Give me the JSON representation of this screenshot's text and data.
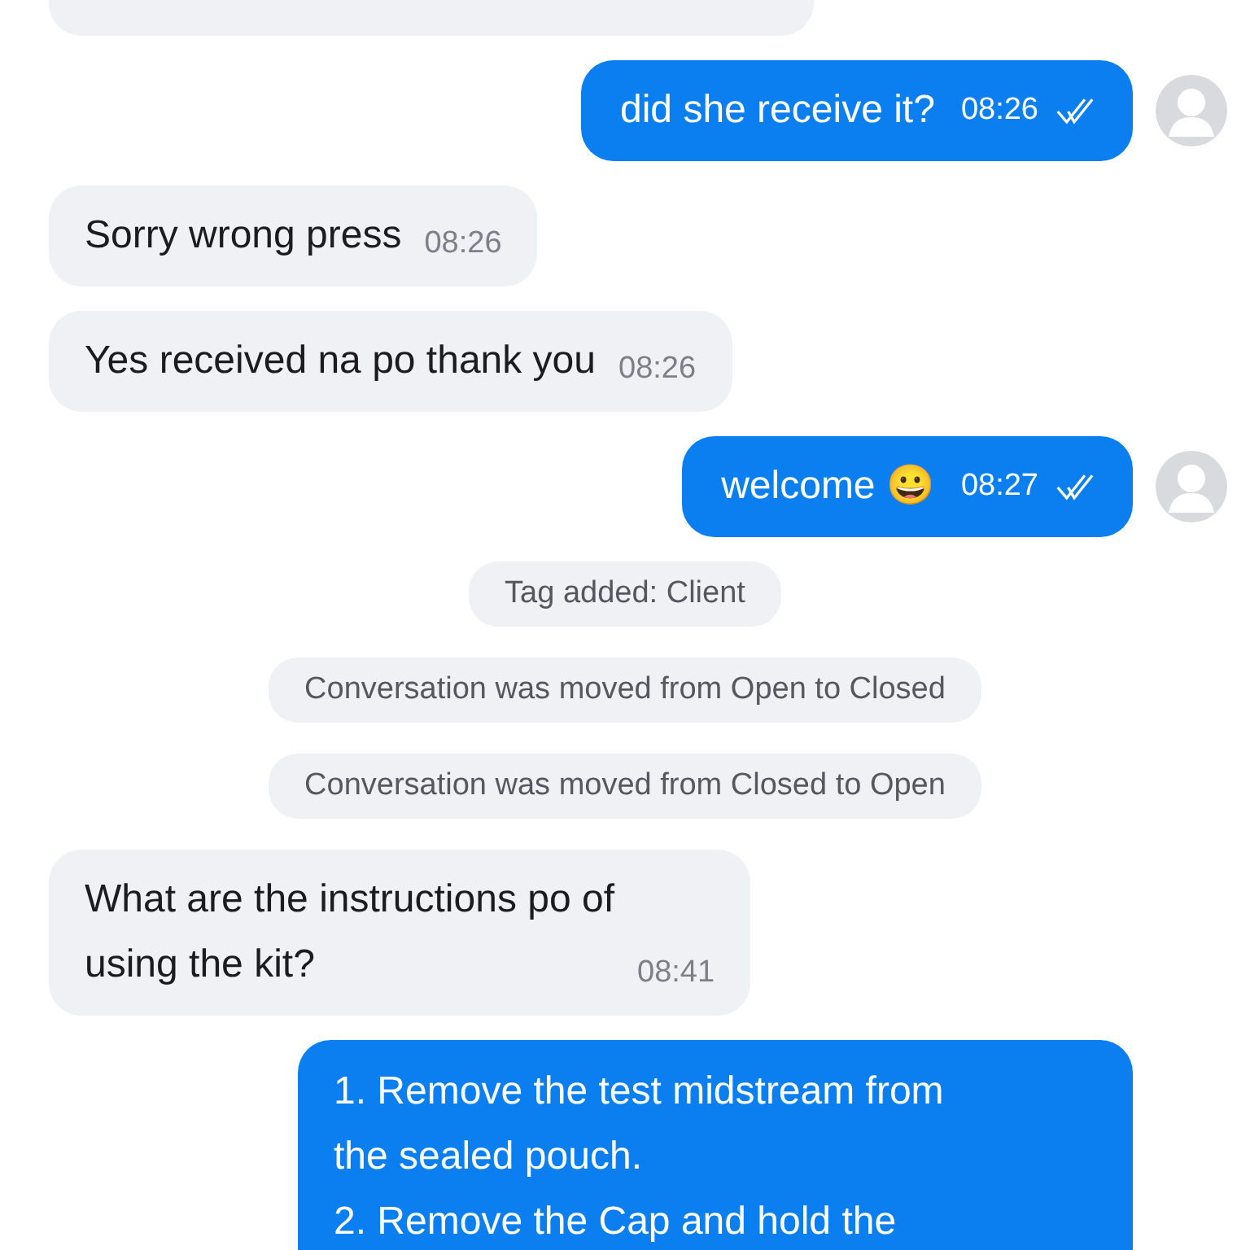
{
  "messages": [
    {
      "kind": "fragment"
    },
    {
      "kind": "outgoing",
      "text": "did she receive it?",
      "time": "08:26",
      "read": true,
      "avatar": true
    },
    {
      "kind": "incoming",
      "text": "Sorry wrong press",
      "time": "08:26"
    },
    {
      "kind": "incoming",
      "text": "Yes received na po thank you",
      "time": "08:26"
    },
    {
      "kind": "outgoing",
      "text": "welcome 😀",
      "time": "08:27",
      "read": true,
      "avatar": true
    },
    {
      "kind": "event",
      "text": "Tag added: Client"
    },
    {
      "kind": "event",
      "text": "Conversation was moved from Open to Closed"
    },
    {
      "kind": "event",
      "text": "Conversation was moved from Closed to Open"
    },
    {
      "kind": "incoming",
      "text": "What are the instructions po of\nusing the kit?",
      "time": "08:41"
    },
    {
      "kind": "outgoing",
      "text": "1. Remove the test midstream from\nthe sealed pouch.\n2. Remove the Cap and hold the",
      "avatar": false
    }
  ]
}
